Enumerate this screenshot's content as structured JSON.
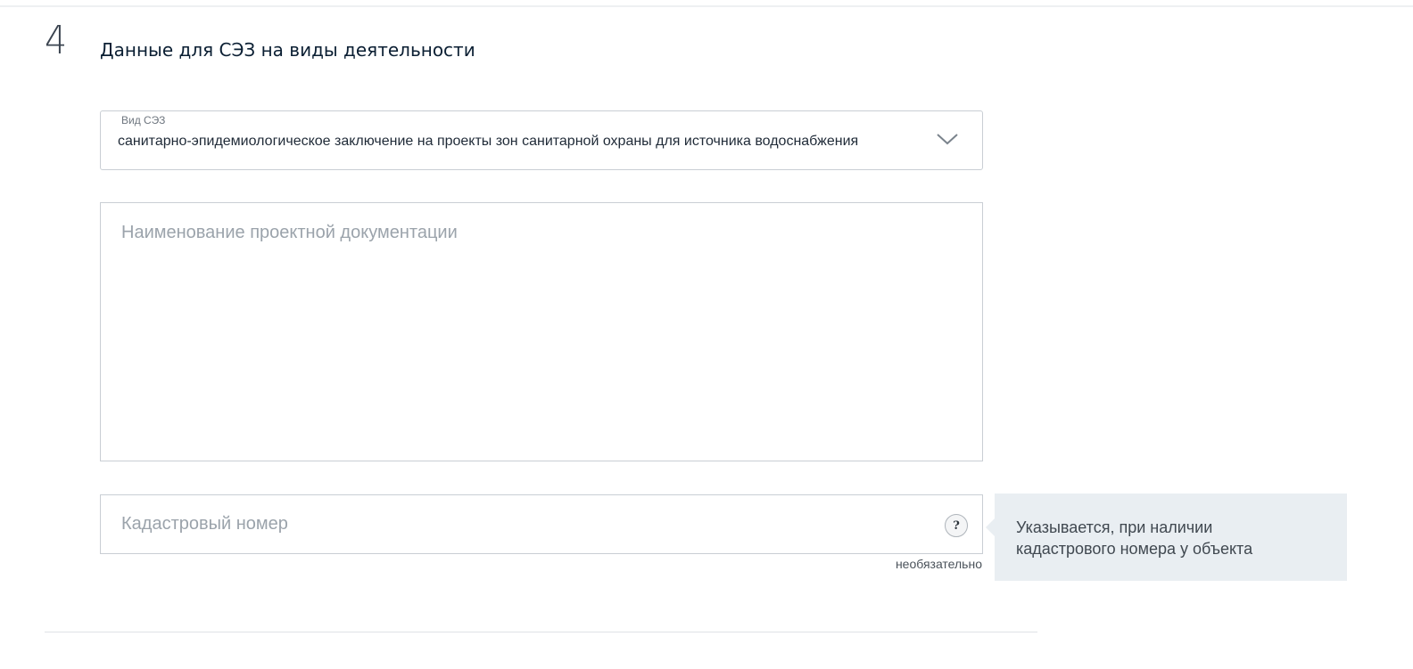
{
  "section": {
    "number": "4",
    "title": "Данные для СЭЗ на виды деятельности"
  },
  "sez_type": {
    "label": "Вид СЭЗ",
    "value": "санитарно-эпидемиологическое заключение на проекты зон санитарной охраны для источника водоснабжения",
    "icon": "chevron-down-icon"
  },
  "project_doc": {
    "placeholder": "Наименование проектной документации"
  },
  "cadastral": {
    "placeholder": "Кадастровый номер",
    "help_symbol": "?",
    "optional_note": "необязательно",
    "hint": "Указывается, при наличии кадастрового номера у объекта"
  },
  "colors": {
    "border": "#c9ced4",
    "placeholder": "#9ba3ab",
    "tooltip_bg": "#e9eef2",
    "title": "#0b1f33"
  }
}
